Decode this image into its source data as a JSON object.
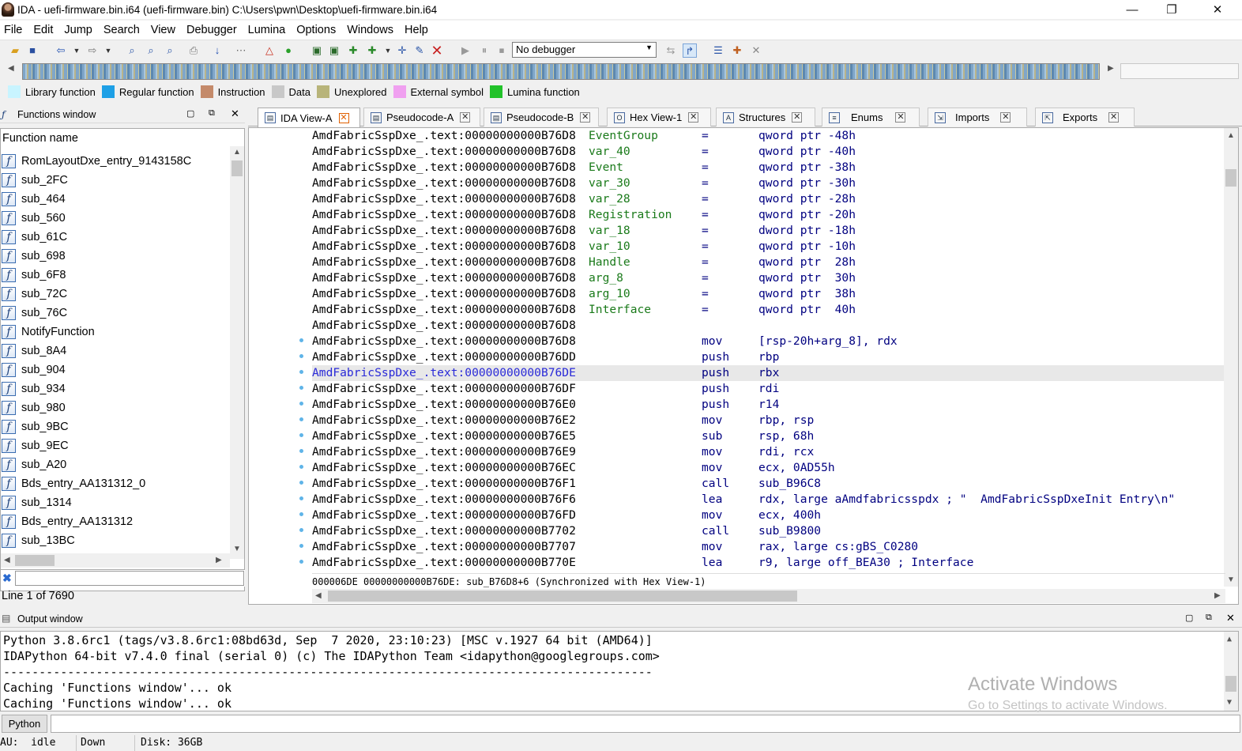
{
  "window": {
    "title": "IDA - uefi-firmware.bin.i64 (uefi-firmware.bin) C:\\Users\\pwn\\Desktop\\uefi-firmware.bin.i64",
    "minimize": "—",
    "maximize": "❐",
    "close": "✕"
  },
  "menu": [
    "File",
    "Edit",
    "Jump",
    "Search",
    "View",
    "Debugger",
    "Lumina",
    "Options",
    "Windows",
    "Help"
  ],
  "toolbar": {
    "debugger": "No debugger"
  },
  "legend": [
    {
      "label": "Library function",
      "color": "#c8f4ff"
    },
    {
      "label": "Regular function",
      "color": "#1ea0e6"
    },
    {
      "label": "Instruction",
      "color": "#c48a6a"
    },
    {
      "label": "Data",
      "color": "#c8c8c8"
    },
    {
      "label": "Unexplored",
      "color": "#b8b47a"
    },
    {
      "label": "External symbol",
      "color": "#f0a0f0"
    },
    {
      "label": "Lumina function",
      "color": "#22c22a"
    }
  ],
  "functions_window": {
    "title": "Functions window",
    "header": "Function name",
    "items": [
      "RomLayoutDxe_entry_9143158C",
      "sub_2FC",
      "sub_464",
      "sub_560",
      "sub_61C",
      "sub_698",
      "sub_6F8",
      "sub_72C",
      "sub_76C",
      "NotifyFunction",
      "sub_8A4",
      "sub_904",
      "sub_934",
      "sub_980",
      "sub_9BC",
      "sub_9EC",
      "sub_A20",
      "Bds_entry_AA131312_0",
      "sub_1314",
      "Bds_entry_AA131312",
      "sub_13BC"
    ],
    "status": "Line 1 of 7690"
  },
  "tabs": [
    "IDA View-A",
    "Pseudocode-A",
    "Pseudocode-B",
    "Hex View-1",
    "Structures",
    "Enums",
    "Imports",
    "Exports"
  ],
  "ida_view": {
    "lines": [
      {
        "addr": "AmdFabricSspDxe_.text:00000000000B76D8",
        "name": "EventGroup",
        "op": "=",
        "arg": "qword ptr -48h"
      },
      {
        "addr": "AmdFabricSspDxe_.text:00000000000B76D8",
        "name": "var_40",
        "op": "=",
        "arg": "qword ptr -40h"
      },
      {
        "addr": "AmdFabricSspDxe_.text:00000000000B76D8",
        "name": "Event",
        "op": "=",
        "arg": "qword ptr -38h"
      },
      {
        "addr": "AmdFabricSspDxe_.text:00000000000B76D8",
        "name": "var_30",
        "op": "=",
        "arg": "qword ptr -30h"
      },
      {
        "addr": "AmdFabricSspDxe_.text:00000000000B76D8",
        "name": "var_28",
        "op": "=",
        "arg": "qword ptr -28h"
      },
      {
        "addr": "AmdFabricSspDxe_.text:00000000000B76D8",
        "name": "Registration",
        "op": "=",
        "arg": "qword ptr -20h"
      },
      {
        "addr": "AmdFabricSspDxe_.text:00000000000B76D8",
        "name": "var_18",
        "op": "=",
        "arg": "dword ptr -18h"
      },
      {
        "addr": "AmdFabricSspDxe_.text:00000000000B76D8",
        "name": "var_10",
        "op": "=",
        "arg": "qword ptr -10h"
      },
      {
        "addr": "AmdFabricSspDxe_.text:00000000000B76D8",
        "name": "Handle",
        "op": "=",
        "arg": "qword ptr  28h"
      },
      {
        "addr": "AmdFabricSspDxe_.text:00000000000B76D8",
        "name": "arg_8",
        "op": "=",
        "arg": "qword ptr  30h"
      },
      {
        "addr": "AmdFabricSspDxe_.text:00000000000B76D8",
        "name": "arg_10",
        "op": "=",
        "arg": "qword ptr  38h"
      },
      {
        "addr": "AmdFabricSspDxe_.text:00000000000B76D8",
        "name": "Interface",
        "op": "=",
        "arg": "qword ptr  40h"
      },
      {
        "addr": "AmdFabricSspDxe_.text:00000000000B76D8",
        "name": "",
        "op": "",
        "arg": ""
      },
      {
        "addr": "AmdFabricSspDxe_.text:00000000000B76D8",
        "name": "",
        "op": "mov",
        "arg": "[rsp-20h+arg_8], rdx"
      },
      {
        "addr": "AmdFabricSspDxe_.text:00000000000B76DD",
        "name": "",
        "op": "push",
        "arg": "rbp"
      },
      {
        "addr": "AmdFabricSspDxe_.text:00000000000B76DE",
        "name": "",
        "op": "push",
        "arg": "rbx",
        "hl": true
      },
      {
        "addr": "AmdFabricSspDxe_.text:00000000000B76DF",
        "name": "",
        "op": "push",
        "arg": "rdi"
      },
      {
        "addr": "AmdFabricSspDxe_.text:00000000000B76E0",
        "name": "",
        "op": "push",
        "arg": "r14"
      },
      {
        "addr": "AmdFabricSspDxe_.text:00000000000B76E2",
        "name": "",
        "op": "mov",
        "arg": "rbp, rsp"
      },
      {
        "addr": "AmdFabricSspDxe_.text:00000000000B76E5",
        "name": "",
        "op": "sub",
        "arg": "rsp, 68h"
      },
      {
        "addr": "AmdFabricSspDxe_.text:00000000000B76E9",
        "name": "",
        "op": "mov",
        "arg": "rdi, rcx"
      },
      {
        "addr": "AmdFabricSspDxe_.text:00000000000B76EC",
        "name": "",
        "op": "mov",
        "arg": "ecx, 0AD55h"
      },
      {
        "addr": "AmdFabricSspDxe_.text:00000000000B76F1",
        "name": "",
        "op": "call",
        "arg": "sub_B96C8"
      },
      {
        "addr": "AmdFabricSspDxe_.text:00000000000B76F6",
        "name": "",
        "op": "lea",
        "arg": "rdx, large aAmdfabricsspdx ; \"  AmdFabricSspDxeInit Entry\\n\""
      },
      {
        "addr": "AmdFabricSspDxe_.text:00000000000B76FD",
        "name": "",
        "op": "mov",
        "arg": "ecx, 400h"
      },
      {
        "addr": "AmdFabricSspDxe_.text:00000000000B7702",
        "name": "",
        "op": "call",
        "arg": "sub_B9800"
      },
      {
        "addr": "AmdFabricSspDxe_.text:00000000000B7707",
        "name": "",
        "op": "mov",
        "arg": "rax, large cs:gBS_C0280"
      },
      {
        "addr": "AmdFabricSspDxe_.text:00000000000B770E",
        "name": "",
        "op": "lea",
        "arg": "r9, large off_BEA30 ; Interface"
      }
    ],
    "status": "000006DE 00000000000B76DE: sub_B76D8+6 (Synchronized with Hex View-1)"
  },
  "output_window": {
    "title": "Output window",
    "lines": [
      "Python 3.8.6rc1 (tags/v3.8.6rc1:08bd63d, Sep  7 2020, 23:10:23) [MSC v.1927 64 bit (AMD64)]",
      "IDAPython 64-bit v7.4.0 final (serial 0) (c) The IDAPython Team <idapython@googlegroups.com>",
      "-------------------------------------------------------------------------------------------",
      "Caching 'Functions window'... ok",
      "Caching 'Functions window'... ok"
    ]
  },
  "watermark": {
    "line1": "Activate Windows",
    "line2": "Go to Settings to activate Windows."
  },
  "cmd": {
    "lang": "Python"
  },
  "statusbar": {
    "au": "AU:  idle",
    "dir": "Down",
    "disk": "Disk: 36GB"
  }
}
